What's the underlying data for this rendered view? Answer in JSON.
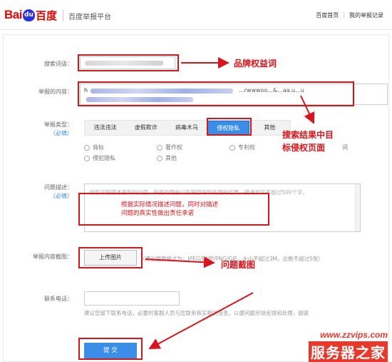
{
  "header": {
    "logo": {
      "bai": "Bai",
      "du": "du",
      "cn": "百度"
    },
    "site_title": "百度举报平台",
    "nav": [
      "百度首页",
      "我的举报记录"
    ]
  },
  "form": {
    "keyword_label": "搜索词语：",
    "content_label": "举报的内容：",
    "content_value_start": "h",
    "content_value_mid": "...rwwwoo...&...aa.u...u",
    "content_value_line2": "...",
    "type_label": "举报类型：",
    "required": "（必填）",
    "tabs": [
      "违法违法",
      "虚假欺诈",
      "病毒木马",
      "侵权隐私",
      "其他"
    ],
    "active_tab_index": 3,
    "radios_row1": [
      "商标",
      "著作权",
      "专利权"
    ],
    "radios_row2": [
      "侵犯隐私",
      "其他"
    ],
    "radio_row1_extra": "词",
    "description_label": "问题描述：",
    "description_placeholder": "请您详细描述遇到的问题，举报的理由以及期望得到处理的结果，描述文字不超过500个字。",
    "screenshot_label": "举报内容截图：",
    "upload_button": "上传图片",
    "upload_hint": "（建议截图格式为：JPEG/BMP/PNG/GIF，大小不超过3M，总数不超过5张）",
    "phone_label": "联系电话：",
    "phone_hint": "建议您留下联系电话，必要时客服人员与您联系核实相关信息，以便问题尽快反馈和处理，谢谢",
    "submit_button": "提 交"
  },
  "annotations": {
    "brand_right": "品牌权益词",
    "search_result": "搜索结果中目",
    "search_result_line2": "标侵权页面",
    "desc_line1": "根据实际情况描述问题，同时对描述",
    "desc_line2": "问题的真实性做出责任承诺",
    "screenshot": "问题截图"
  },
  "watermark": {
    "url": "www.zzvips.com",
    "brand": "服务器之家"
  },
  "colors": {
    "accent": "#3b8ee8",
    "annotation_red": "#d9141b",
    "baidu_red": "#e10601",
    "baidu_blue": "#2932e1"
  }
}
